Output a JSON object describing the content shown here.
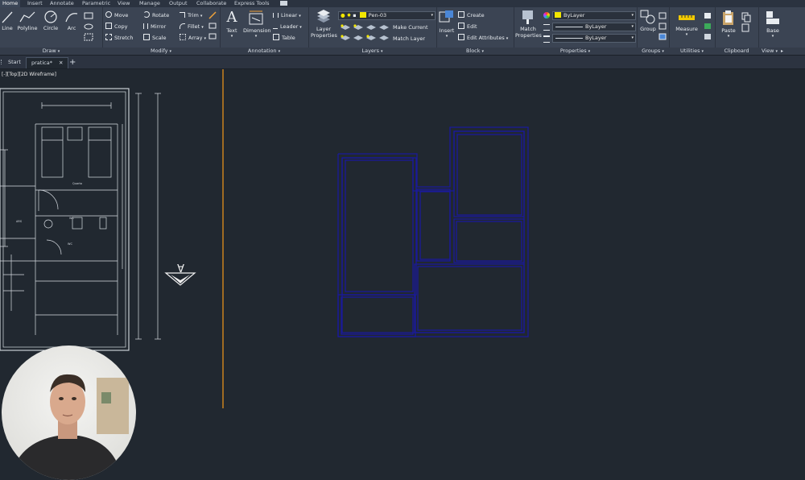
{
  "menu": {
    "tabs": [
      "Home",
      "Insert",
      "Annotate",
      "Parametric",
      "View",
      "Manage",
      "Output",
      "Collaborate",
      "Express Tools"
    ],
    "active": "Home"
  },
  "ribbon": {
    "draw": {
      "title": "Draw",
      "tools": [
        "Line",
        "Polyline",
        "Circle",
        "Arc"
      ]
    },
    "modify": {
      "title": "Modify",
      "col1": [
        "Move",
        "Copy",
        "Stretch"
      ],
      "col2": [
        "Rotate",
        "Mirror",
        "Scale"
      ],
      "col3": [
        "Trim",
        "Fillet",
        "Array"
      ]
    },
    "annotation": {
      "title": "Annotation",
      "tools": [
        "Text",
        "Dimension"
      ],
      "col": [
        "Linear",
        "Leader",
        "Table"
      ]
    },
    "layers": {
      "title": "Layers",
      "properties_button": "Layer Properties",
      "current_layer": "Pen-03",
      "actions": [
        "Make Current",
        "Match Layer"
      ]
    },
    "block": {
      "title": "Block",
      "insert": "Insert",
      "actions": [
        "Create",
        "Edit",
        "Edit Attributes"
      ]
    },
    "properties": {
      "title": "Properties",
      "match": "Match Properties",
      "color": "ByLayer",
      "linetype": "ByLayer",
      "lineweight": "ByLayer"
    },
    "groups": {
      "title": "Groups",
      "group": "Group"
    },
    "utilities": {
      "title": "Utilities",
      "measure": "Measure"
    },
    "clipboard": {
      "title": "Clipboard",
      "paste": "Paste"
    },
    "view": {
      "title": "View",
      "base": "Base"
    }
  },
  "filetabs": {
    "start": "Start",
    "active": "pratica*",
    "new": "+"
  },
  "viewport": {
    "label": "[-][Top][2D Wireframe]"
  },
  "drawing": {
    "room_labels": [
      "Quarto",
      "WC",
      "ARS",
      "WC"
    ]
  },
  "colors": {
    "background": "#212830",
    "floorplan": "#1a1a9a",
    "divider": "#c9811e"
  }
}
